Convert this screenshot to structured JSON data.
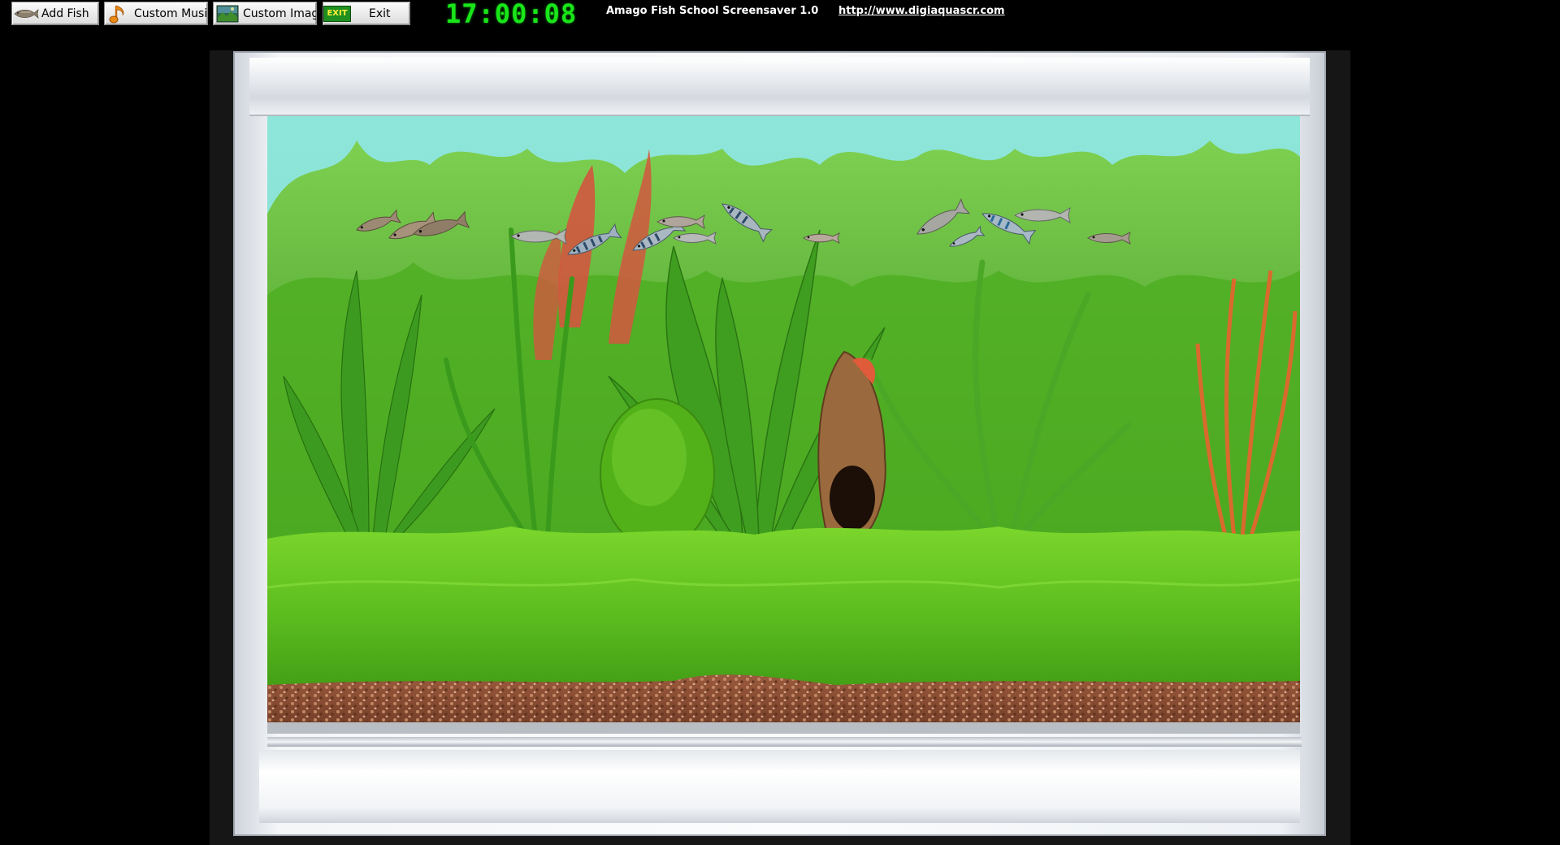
{
  "toolbar": {
    "add_fish_label": "Add Fish",
    "custom_music_label": "Custom Music",
    "custom_image_label": "Custom Image",
    "exit_label": "Exit",
    "exit_icon_text": "EXIT"
  },
  "clock": {
    "time": "17:00:08"
  },
  "app": {
    "title": "Amago Fish School Screensaver 1.0",
    "link": "http://www.digiaquascr.com"
  },
  "colors": {
    "clock": "#19e619",
    "water": "#86e0d6",
    "plants": "#3fae1c",
    "moss": "#6fcf2a",
    "gravel": "#8a4b33"
  },
  "icons": {
    "add_fish": "fish-icon",
    "custom_music": "music-note-icon",
    "custom_image": "landscape-image-icon",
    "exit": "exit-icon"
  }
}
